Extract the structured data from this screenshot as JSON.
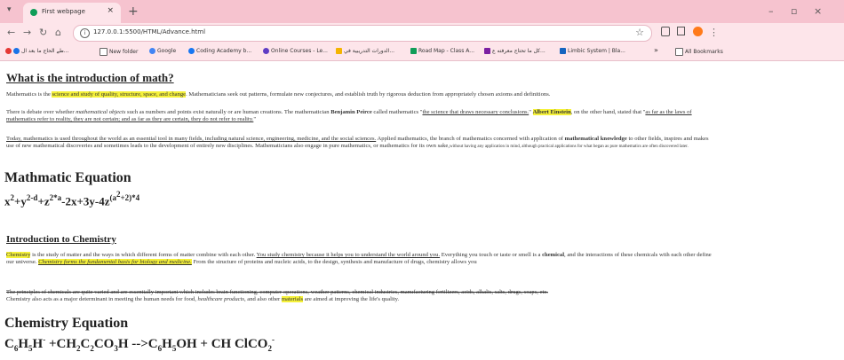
{
  "browser": {
    "tab_title": "First webpage",
    "tab_close": "×",
    "new_tab": "+",
    "url": "127.0.0.1:5500/HTML/Advance.html",
    "controls": {
      "minimize": "–",
      "restore": "▫",
      "close": "×"
    },
    "bookmarks": [
      {
        "label": "طے الحاج ما بعد ال..."
      },
      {
        "label": "New folder"
      },
      {
        "label": "Google"
      },
      {
        "label": "Coding Academy b..."
      },
      {
        "label": "Online Courses - Le..."
      },
      {
        "label": "الدورات التدريبية في..."
      },
      {
        "label": "Road Map - Class A..."
      },
      {
        "label": "كل ما تحتاج معرفته ع..."
      },
      {
        "label": "Limbic System | Bla..."
      }
    ],
    "more_bookmarks": "»",
    "all_bookmarks": "All Bookmarks"
  },
  "math": {
    "heading": "What is the introduction of math?",
    "p1_a": "Mathematics is the ",
    "p1_hl": "science and study of quality, structure, space, and change",
    "p1_b": ". Mathematicians seek out patterns, formulate new conjectures, and establish truth by rigorous deduction from appropriately chosen axioms and definitions.",
    "p2_a": "There is debate over whether ",
    "p2_i": "mathematical objects",
    "p2_b": " such as numbers and points exist naturally or are human creations. The mathematician ",
    "p2_bold": "Benjamin Peirce",
    "p2_c": " called mathematics \"",
    "p2_ul": "the science that draws necessary conclusions.",
    "p2_d": "\" ",
    "p2_hl": "Albert Einstein",
    "p2_e": ", on the other hand, stated that \"",
    "p2_ul2": "as far as the laws of mathematics refer to reality, they are not certain; and as far as they are certain, they do not refer to reality.",
    "p2_f": "\"",
    "p3_ul": "Today, mathematics is used throughout the world as an essential tool in many fields, including natural science, engineering, medicine, and the social sciences.",
    "p3_a": " Applied mathematics, the branch of mathematics concerned with application of ",
    "p3_bold": "mathematical knowledge",
    "p3_b": " to other fields, inspires and makes use of new mathematical discoveries and sometimes leads to the development of entirely new disciplines. Mathematicians also engage in pure mathematics, or mathematics for its own sake,",
    "p3_small": "without having any application in mind, although practical applications for what began as pure mathematics are often discovered later.",
    "eq_title": "Mathmatic Equation",
    "eq": {
      "x": "x",
      "x_sup": "2",
      "p1": "+y",
      "y_sup": "2-d",
      "p2": "+z",
      "z_sup": "2*a",
      "rest": "-2x+3y-4z",
      "exp": "(a",
      "exp_sup": "2",
      "exp_end": "+2)*4"
    }
  },
  "chem": {
    "heading": "Introduction to Chemistry",
    "p1_hl": "Chemistry",
    "p1_a": " is the study of matter and the ways in which different forms of matter combine with each other. ",
    "p1_ul": "You study chemistry because it helps you to understand the world around you.",
    "p1_b": " Everything you touch or taste or smell is a ",
    "p1_bold": "chemical",
    "p1_c": ", and the interactions of these chemicals with each other define our universe. ",
    "p1_hl2": "Chemistry forms the fundamental basis for biology and medicine.",
    "p1_d": " From the structure of proteins and nucleic acids, to the design, synthesis and manufacture of drugs, chemistry allows you",
    "p2_st": "The principles of chemicals are quite varied and are essentially important which includes brain functioning, computer operations, weather patterns, chemical industries, manufacturing fertilizers, acids, alkalis, salts, drugs, soaps, etc.",
    "p2_a": "Chemistry also acts as a major determinant in meeting the human needs for food, ",
    "p2_i": "healthcare products",
    "p2_b": ", and also other ",
    "p2_hl": "materials",
    "p2_c": " are aimed at improving the life's quality.",
    "eq_title": "Chemistry Equation",
    "eq": {
      "c1": "C",
      "s1": "6",
      "h1": "H",
      "s2": "5",
      "h2": "H",
      "sup1": "-",
      "mid": " +CH",
      "s3": "2",
      "c2": "C",
      "s4": "2",
      "co": "CO",
      "s5": "3",
      "h3": "H -->C",
      "s6": "6",
      "h4": "H",
      "s7": "5",
      "end": "OH + CH ClCO",
      "s8": "2",
      "sup2": "-"
    }
  }
}
